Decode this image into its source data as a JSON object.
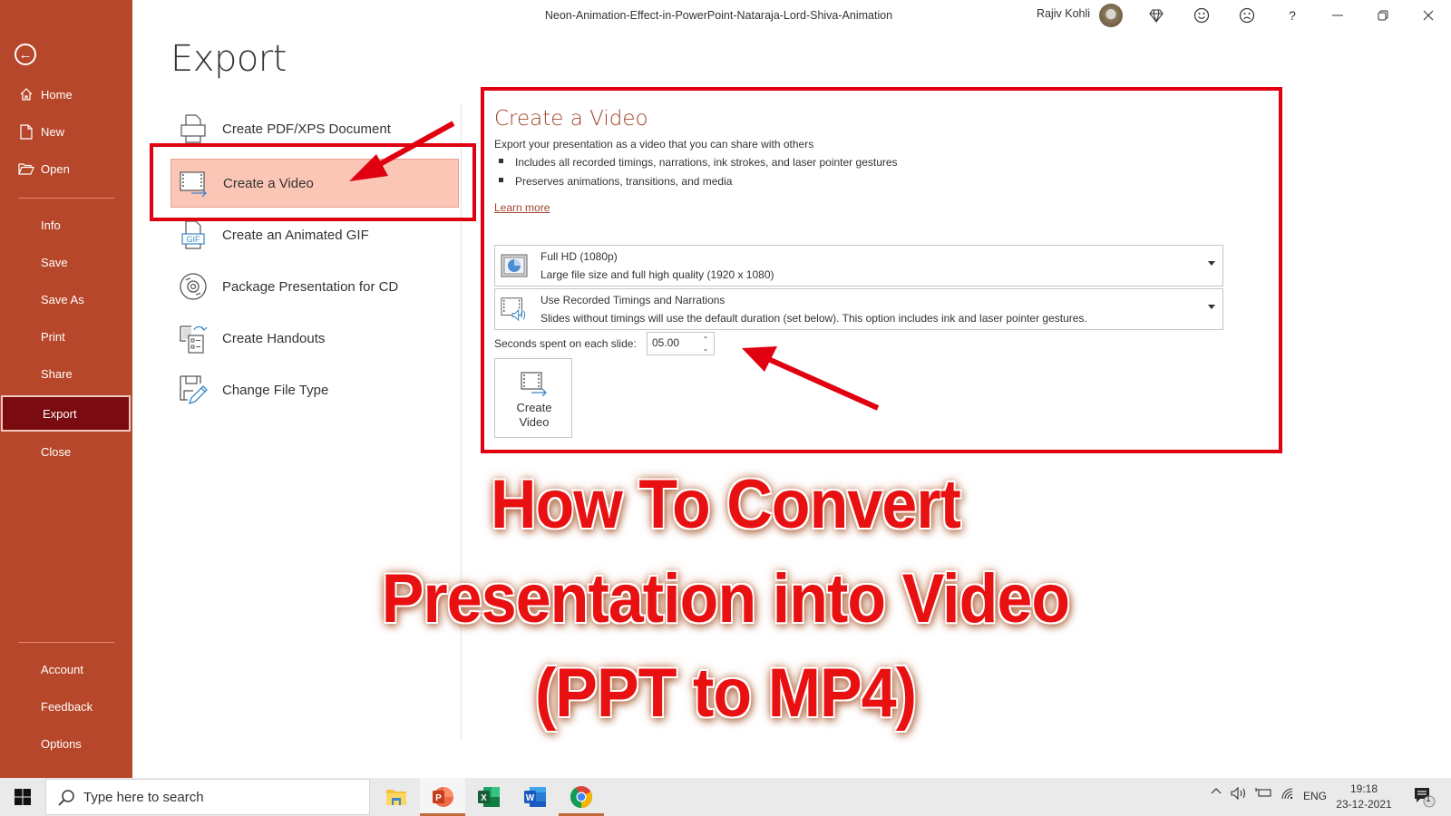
{
  "window": {
    "title": "Neon-Animation-Effect-in-PowerPoint-Nataraja-Lord-Shiva-Animation",
    "user_name": "Rajiv Kohli",
    "icons": [
      "diamond-icon",
      "smiley-icon",
      "frown-icon",
      "help-icon",
      "minimize-icon",
      "restore-icon",
      "close-icon"
    ],
    "help_label": "?"
  },
  "sidebar": {
    "back_icon": "back-arrow-icon",
    "top_items": [
      {
        "label": "Home",
        "icon": "home-icon"
      },
      {
        "label": "New",
        "icon": "new-document-icon"
      },
      {
        "label": "Open",
        "icon": "open-folder-icon"
      }
    ],
    "middle_items": [
      {
        "label": "Info"
      },
      {
        "label": "Save"
      },
      {
        "label": "Save As"
      },
      {
        "label": "Print"
      },
      {
        "label": "Share"
      },
      {
        "label": "Export",
        "active": true
      },
      {
        "label": "Close"
      }
    ],
    "bottom_items": [
      {
        "label": "Account"
      },
      {
        "label": "Feedback"
      },
      {
        "label": "Options"
      }
    ],
    "brand_color": "#b7472a",
    "active_color": "#7a0b10"
  },
  "page": {
    "title": "Export"
  },
  "export_menu": {
    "items": [
      {
        "label": "Create PDF/XPS Document",
        "icon": "pdf-document-icon"
      },
      {
        "label": "Create a Video",
        "icon": "video-icon",
        "selected": true
      },
      {
        "label": "Create an Animated GIF",
        "icon": "gif-icon"
      },
      {
        "label": "Package Presentation for CD",
        "icon": "cd-icon"
      },
      {
        "label": "Create Handouts",
        "icon": "handouts-icon"
      },
      {
        "label": "Change File Type",
        "icon": "change-file-type-icon"
      }
    ],
    "selected_bg": "#fbc6b5"
  },
  "video_panel": {
    "title": "Create a Video",
    "description": "Export your presentation as a video that you can share with others",
    "bullets": [
      "Includes all recorded timings, narrations, ink strokes, and laser pointer gestures",
      "Preserves animations, transitions, and media"
    ],
    "learn_more": "Learn more",
    "quality_dropdown": {
      "selected": "Full HD (1080p)",
      "subtitle": "Large file size and full high quality (1920 x 1080)"
    },
    "timings_dropdown": {
      "selected": "Use Recorded Timings and Narrations",
      "subtitle": "Slides without timings will use the default duration (set below). This option includes ink and laser pointer gestures."
    },
    "seconds_label": "Seconds spent on each slide:",
    "seconds_value": "05.00",
    "create_button": {
      "line1": "Create",
      "line2": "Video"
    }
  },
  "overlay_title": {
    "lines": [
      "How To Convert",
      "Presentation into Video",
      "(PPT to MP4)"
    ],
    "color": "#e81010"
  },
  "annotation_color": "#e00010",
  "taskbar": {
    "search_placeholder": "Type here to search",
    "apps": [
      {
        "name": "File Explorer",
        "icon": "file-explorer-icon"
      },
      {
        "name": "PowerPoint",
        "icon": "powerpoint-icon",
        "active": true
      },
      {
        "name": "Excel",
        "icon": "excel-icon"
      },
      {
        "name": "Word",
        "icon": "word-icon"
      },
      {
        "name": "Chrome",
        "icon": "chrome-icon",
        "running": true
      }
    ],
    "language": "ENG",
    "time": "19:18",
    "date": "23-12-2021",
    "notification_count": "1"
  }
}
